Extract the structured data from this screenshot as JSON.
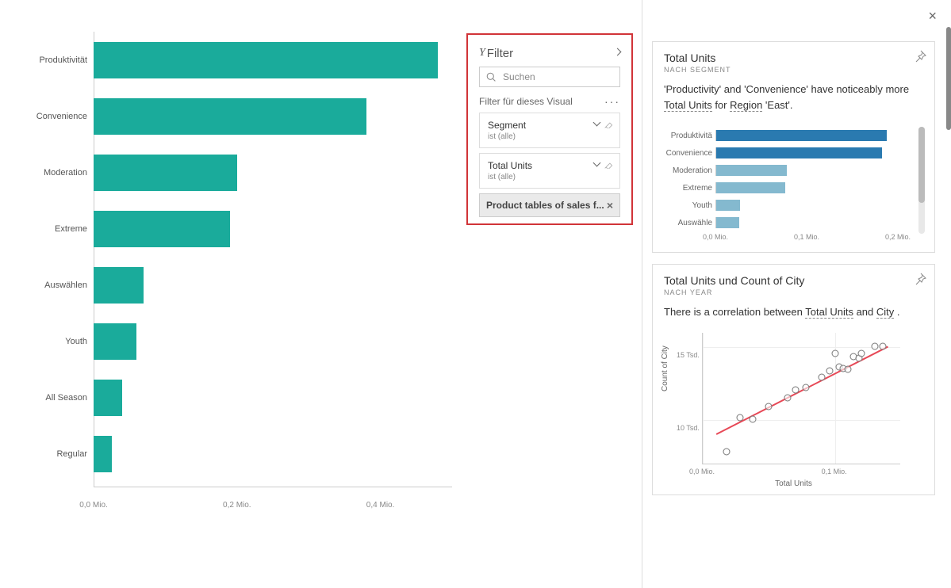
{
  "main_chart": {
    "type": "bar",
    "orientation": "horizontal",
    "categories": [
      "Produktivität",
      "Convenience",
      "Moderation",
      "Extreme",
      "Auswählen",
      "Youth",
      "All Season",
      "Regular"
    ],
    "values": [
      0.48,
      0.38,
      0.2,
      0.19,
      0.07,
      0.06,
      0.04,
      0.025
    ],
    "x_ticks": [
      0.0,
      0.2,
      0.4
    ],
    "x_tick_labels": [
      "0,0 Mio.",
      "0,2 Mio.",
      "0,4 Mio."
    ]
  },
  "filter_pane": {
    "icon_label": "Y",
    "title": "Filter",
    "search_placeholder": "Suchen",
    "section_title": "Filter für dieses Visual",
    "cards": [
      {
        "name": "Segment",
        "sub": "ist (alle)"
      },
      {
        "name": "Total Units",
        "sub": "ist (alle)"
      }
    ],
    "chip_label": "Product tables of sales f..."
  },
  "insights": {
    "close_label": "×",
    "cards": [
      {
        "title": "Total Units",
        "subtitle": "NACH SEGMENT",
        "text_parts": [
          "'Productivity' and 'Convenience' have noticeably more ",
          "Total Units",
          " for ",
          "Region",
          " 'East'."
        ],
        "chart_data": {
          "type": "bar",
          "orientation": "horizontal",
          "categories": [
            "Produktivitä",
            "Convenience",
            "Moderation",
            "Extreme",
            "Youth",
            "Auswähle"
          ],
          "values": [
            0.165,
            0.16,
            0.068,
            0.067,
            0.023,
            0.022
          ],
          "emphasis": [
            true,
            true,
            false,
            false,
            false,
            false
          ],
          "x_ticks": [
            0.0,
            0.1,
            0.2
          ],
          "x_tick_labels": [
            "0,0 Mio.",
            "0,1 Mio.",
            "0,2 Mio."
          ]
        }
      },
      {
        "title": "Total Units und Count of City",
        "subtitle": "NACH YEAR",
        "text_parts": [
          "There is a correlation between ",
          "Total Units",
          " and ",
          "City",
          " ."
        ],
        "chart_data": {
          "type": "scatter",
          "xlabel": "Total Units",
          "ylabel": "Count of City",
          "x_ticks": [
            0.0,
            0.1
          ],
          "x_tick_labels": [
            "0,0 Mio.",
            "0,1 Mio."
          ],
          "y_ticks": [
            10,
            15
          ],
          "y_tick_labels": [
            "10 Tsd.",
            "15 Tsd."
          ],
          "xlim": [
            0.0,
            0.15
          ],
          "ylim": [
            7,
            16
          ],
          "points": [
            {
              "x": 0.018,
              "y": 7.8
            },
            {
              "x": 0.028,
              "y": 10.1
            },
            {
              "x": 0.038,
              "y": 10.0
            },
            {
              "x": 0.05,
              "y": 10.9
            },
            {
              "x": 0.064,
              "y": 11.5
            },
            {
              "x": 0.07,
              "y": 12.0
            },
            {
              "x": 0.078,
              "y": 12.2
            },
            {
              "x": 0.09,
              "y": 12.9
            },
            {
              "x": 0.096,
              "y": 13.3
            },
            {
              "x": 0.103,
              "y": 13.6
            },
            {
              "x": 0.106,
              "y": 13.5
            },
            {
              "x": 0.11,
              "y": 13.4
            },
            {
              "x": 0.1,
              "y": 14.5
            },
            {
              "x": 0.114,
              "y": 14.3
            },
            {
              "x": 0.118,
              "y": 14.2
            },
            {
              "x": 0.12,
              "y": 14.5
            },
            {
              "x": 0.13,
              "y": 15.0
            },
            {
              "x": 0.136,
              "y": 15.0
            }
          ],
          "trendline": {
            "x1": 0.01,
            "y1": 9.1,
            "x2": 0.14,
            "y2": 15.1
          }
        }
      }
    ]
  },
  "chart_data": [
    {
      "type": "bar",
      "title": "Main horizontal bar chart",
      "categories": [
        "Produktivität",
        "Convenience",
        "Moderation",
        "Extreme",
        "Auswählen",
        "Youth",
        "All Season",
        "Regular"
      ],
      "values": [
        0.48,
        0.38,
        0.2,
        0.19,
        0.07,
        0.06,
        0.04,
        0.025
      ],
      "xlabel": "",
      "ylabel": "",
      "xlim": [
        0,
        0.5
      ],
      "unit": "Mio."
    },
    {
      "type": "bar",
      "title": "Total Units nach Segment (East)",
      "categories": [
        "Produktivität",
        "Convenience",
        "Moderation",
        "Extreme",
        "Youth",
        "Auswählen"
      ],
      "values": [
        0.165,
        0.16,
        0.068,
        0.067,
        0.023,
        0.022
      ],
      "xlabel": "",
      "ylabel": "",
      "xlim": [
        0,
        0.2
      ],
      "unit": "Mio."
    },
    {
      "type": "scatter",
      "title": "Total Units und Count of City nach Year",
      "xlabel": "Total Units",
      "ylabel": "Count of City",
      "x": [
        0.018,
        0.028,
        0.038,
        0.05,
        0.064,
        0.07,
        0.078,
        0.09,
        0.096,
        0.103,
        0.106,
        0.11,
        0.1,
        0.114,
        0.118,
        0.12,
        0.13,
        0.136
      ],
      "y": [
        7.8,
        10.1,
        10.0,
        10.9,
        11.5,
        12.0,
        12.2,
        12.9,
        13.3,
        13.6,
        13.5,
        13.4,
        14.5,
        14.3,
        14.2,
        14.5,
        15.0,
        15.0
      ],
      "xlim": [
        0,
        0.15
      ],
      "ylim": [
        7,
        16
      ]
    }
  ]
}
